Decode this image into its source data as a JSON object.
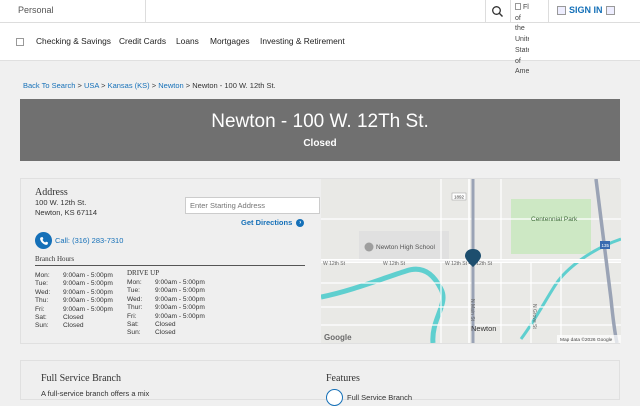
{
  "topbar": {
    "personal_label": "Personal",
    "flag_alt_text": "Flag of the United States of America",
    "signin_label": "SIGN IN"
  },
  "nav": {
    "items": [
      "Checking & Savings",
      "Credit Cards",
      "Loans",
      "Mortgages",
      "Investing & Retirement"
    ]
  },
  "breadcrumb": {
    "items": [
      "Back To Search",
      "USA",
      "Kansas (KS)",
      "Newton"
    ],
    "separator": ">",
    "current": "Newton - 100 W. 12th St."
  },
  "hero": {
    "title": "Newton - 100 W. 12Th St.",
    "status": "Closed"
  },
  "address": {
    "heading": "Address",
    "line1": "100 W. 12th St.",
    "line2": "Newton, KS 67114"
  },
  "directions": {
    "input_placeholder": "Enter Starting Address",
    "button_label": "Get Directions",
    "button_glyph": "›"
  },
  "call": {
    "label": "Call: (316) 283-7310"
  },
  "hours": {
    "heading": "Branch Hours",
    "branch": [
      {
        "day": "Mon:",
        "time": "9:00am - 5:00pm"
      },
      {
        "day": "Tue:",
        "time": "9:00am - 5:00pm"
      },
      {
        "day": "Wed:",
        "time": "9:00am - 5:00pm"
      },
      {
        "day": "Thu:",
        "time": "9:00am - 5:00pm"
      },
      {
        "day": "Fri:",
        "time": "9:00am - 5:00pm"
      },
      {
        "day": "Sat:",
        "time": "Closed"
      },
      {
        "day": "Sun:",
        "time": "Closed"
      }
    ],
    "drive_up_heading": "DRIVE UP",
    "drive_up": [
      {
        "day": "Mon:",
        "time": "9:00am - 5:00pm"
      },
      {
        "day": "Tue:",
        "time": "9:00am - 5:00pm"
      },
      {
        "day": "Wed:",
        "time": "9:00am - 5:00pm"
      },
      {
        "day": "Thur:",
        "time": "9:00am - 5:00pm"
      },
      {
        "day": "Fri:",
        "time": "9:00am - 5:00pm"
      },
      {
        "day": "Sat:",
        "time": "Closed"
      },
      {
        "day": "Sun:",
        "time": "Closed"
      }
    ]
  },
  "map": {
    "labels": {
      "park": "Centennial Park",
      "school": "Newton High School",
      "city": "Newton",
      "w12": "W 12th St",
      "w12b": "W 12th St",
      "e12": "W 12th St • E 12th St",
      "wmain": "N Main St",
      "ngrove": "N Grove St",
      "r1892": "1892",
      "r135": "135"
    },
    "attribution": "Map data ©2026 Google",
    "google_logo": "Google",
    "colors": {
      "water": "#5fcfcf",
      "park": "#c8e6c0",
      "road": "#ffffff",
      "highway": "#9aa3b5",
      "marker": "#1d4e6e"
    }
  },
  "bottom": {
    "branch_heading": "Full Service Branch",
    "branch_text": "A full-service branch offers a mix",
    "features_heading": "Features",
    "feature_item": "Full Service Branch"
  },
  "colors": {
    "accent": "#1570b8",
    "hero_bg": "#707070"
  }
}
